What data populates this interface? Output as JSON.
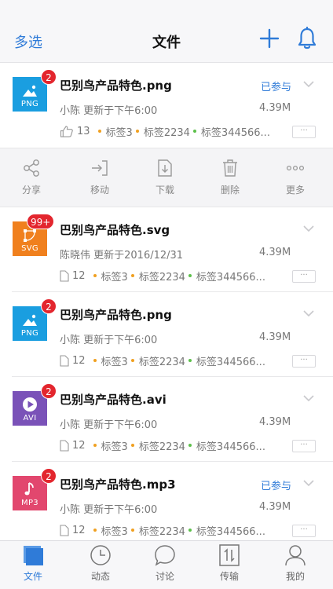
{
  "header": {
    "left_action": "多选",
    "title": "文件",
    "add_icon": "plus-icon",
    "bell_icon": "bell-icon"
  },
  "files": [
    {
      "name": "巴别鸟产品特色.png",
      "ext": "PNG",
      "badge": "2",
      "status": "已参与",
      "meta": "小陈  更新于下午6:00",
      "size": "4.39M",
      "count": "13",
      "tags": [
        "标签3",
        "标签2234",
        "标签344566..."
      ],
      "more": "···",
      "color": "#1a9ee0"
    },
    {
      "name": "巴别鸟产品特色.svg",
      "ext": "SVG",
      "badge": "99+",
      "status": "",
      "meta": "陈晓伟  更新于2016/12/31",
      "size": "4.39M",
      "count": "12",
      "tags": [
        "标签3",
        "标签2234",
        "标签344566..."
      ],
      "more": "···",
      "color": "#f0801e"
    },
    {
      "name": "巴别鸟产品特色.png",
      "ext": "PNG",
      "badge": "2",
      "status": "",
      "meta": "小陈  更新于下午6:00",
      "size": "4.39M",
      "count": "12",
      "tags": [
        "标签3",
        "标签2234",
        "标签344566..."
      ],
      "more": "···",
      "color": "#1a9ee0"
    },
    {
      "name": "巴别鸟产品特色.avi",
      "ext": "AVI",
      "badge": "2",
      "status": "",
      "meta": "小陈  更新于下午6:00",
      "size": "4.39M",
      "count": "12",
      "tags": [
        "标签3",
        "标签2234",
        "标签344566..."
      ],
      "more": "···",
      "color": "#7a52b8"
    },
    {
      "name": "巴别鸟产品特色.mp3",
      "ext": "MP3",
      "badge": "2",
      "status": "已参与",
      "meta": "小陈  更新于下午6:00",
      "size": "4.39M",
      "count": "12",
      "tags": [
        "标签3",
        "标签2234",
        "标签344566..."
      ],
      "more": "···",
      "color": "#e2476e"
    }
  ],
  "actions": [
    {
      "label": "分享",
      "icon": "share-icon"
    },
    {
      "label": "移动",
      "icon": "move-icon"
    },
    {
      "label": "下载",
      "icon": "download-icon"
    },
    {
      "label": "删除",
      "icon": "trash-icon"
    },
    {
      "label": "更多",
      "icon": "more-icon"
    }
  ],
  "tabs": [
    {
      "label": "文件",
      "icon": "files-icon",
      "active": true
    },
    {
      "label": "动态",
      "icon": "clock-icon",
      "active": false
    },
    {
      "label": "讨论",
      "icon": "chat-icon",
      "active": false
    },
    {
      "label": "传输",
      "icon": "transfer-icon",
      "active": false
    },
    {
      "label": "我的",
      "icon": "user-icon",
      "active": false
    }
  ],
  "colors": {
    "accent": "#2f7bd8",
    "badge": "#e3262e",
    "tag_dot_orange": "#f0a020",
    "tag_dot_green": "#5cc04a"
  }
}
